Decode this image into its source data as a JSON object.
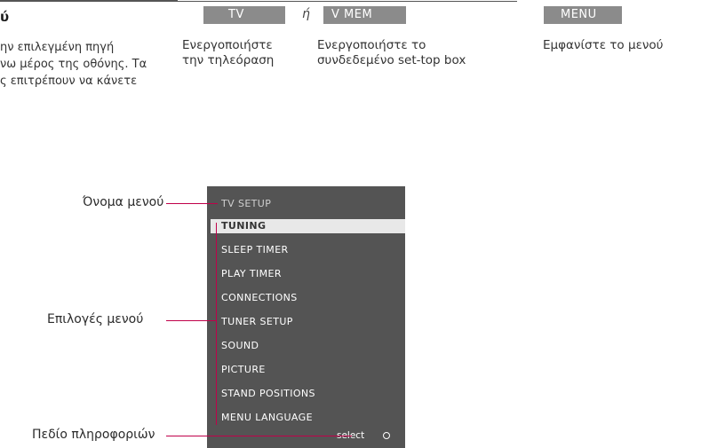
{
  "header": {
    "heading_fragment": "ύ",
    "keys": {
      "tv": "TV",
      "or": "ή",
      "vmem": "V MEM",
      "menu": "MENU"
    }
  },
  "intro_lines": [
    "ην επιλεγμένη πηγή",
    "νω μέρος της οθόνης. Τα",
    "ς επιτρέπουν να κάνετε"
  ],
  "steps": {
    "tv": [
      "Ενεργοποιήστε",
      "την τηλεόραση"
    ],
    "vmem": [
      "Ενεργοποιήστε το",
      "συνδεδεμένο set-top box"
    ],
    "menu": [
      "Εμφανίστε το μενού"
    ]
  },
  "menu": {
    "title": "TV SETUP",
    "items": [
      "TUNING",
      "SLEEP TIMER",
      "PLAY TIMER",
      "CONNECTIONS",
      "TUNER SETUP",
      "SOUND",
      "PICTURE",
      "STAND POSITIONS",
      "MENU LANGUAGE"
    ],
    "selected_index": 0,
    "select_hint": "select"
  },
  "callouts": {
    "menu_name": "Όνομα μενού",
    "menu_options": "Επιλογές μενού",
    "info_field": "Πεδίο πληροφοριών"
  },
  "colors": {
    "keycap": "#8b8b8b",
    "menu_panel": "#545454",
    "leader_line": "#c0004a"
  }
}
